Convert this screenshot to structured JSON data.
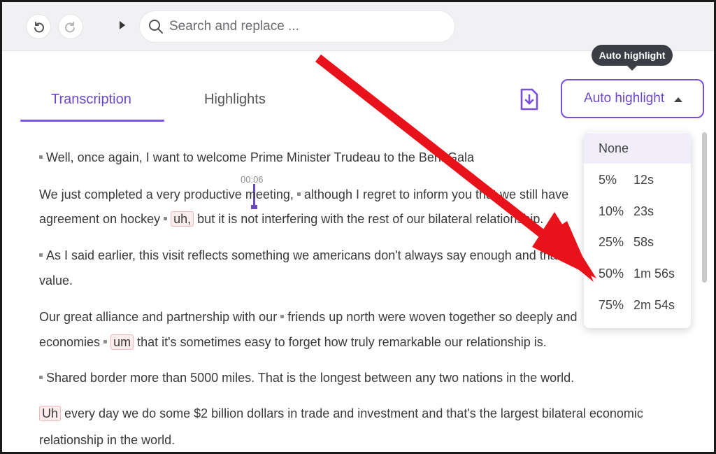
{
  "toolbar": {
    "search_placeholder": "Search and replace ..."
  },
  "tabs": [
    {
      "label": "Transcription",
      "active": true
    },
    {
      "label": "Highlights",
      "active": false
    }
  ],
  "auto_highlight": {
    "button_label": "Auto highlight",
    "tooltip": "Auto highlight",
    "options": [
      {
        "label": "None",
        "pct": "",
        "duration": "",
        "selected": true
      },
      {
        "label": "",
        "pct": "5%",
        "duration": "12s",
        "selected": false
      },
      {
        "label": "",
        "pct": "10%",
        "duration": "23s",
        "selected": false
      },
      {
        "label": "",
        "pct": "25%",
        "duration": "58s",
        "selected": false
      },
      {
        "label": "",
        "pct": "50%",
        "duration": "1m 56s",
        "selected": false
      },
      {
        "label": "",
        "pct": "75%",
        "duration": "2m 54s",
        "selected": false
      }
    ]
  },
  "cursor_time": "00:06",
  "transcript": {
    "l1": "Well, once again, I want to welcome Prime Minister Trudeau to the Beni Gala",
    "l2a": "We just completed a very productive",
    "l2b": "meeting,",
    "l2c": "although I regret to inform you that we still have",
    "l3a": "agreement on hockey",
    "l3_filler": "uh,",
    "l3b": "but it is not interfering with the rest of our bilateral relationship.",
    "l4": "As I said earlier, this visit reflects something we americans don't always say enough and that is",
    "l5": "value.",
    "l6a": "Our great alliance and partnership with our",
    "l6b": "friends up north were woven together so deeply and",
    "l7a": "economies",
    "l7_filler": "um",
    "l7b": "that it's sometimes easy to forget how truly remarkable our relationship is.",
    "l8": "Shared border more than 5000 miles. That is the longest between any two nations in the world.",
    "l9_filler": "Uh",
    "l9b": "every day we do some $2 billion dollars in trade and investment and that's the largest bilateral economic",
    "l10": "relationship in the world."
  },
  "colors": {
    "accent": "#7c4dff",
    "arrow": "#e8121b",
    "filler_border": "#f1b9bd"
  }
}
